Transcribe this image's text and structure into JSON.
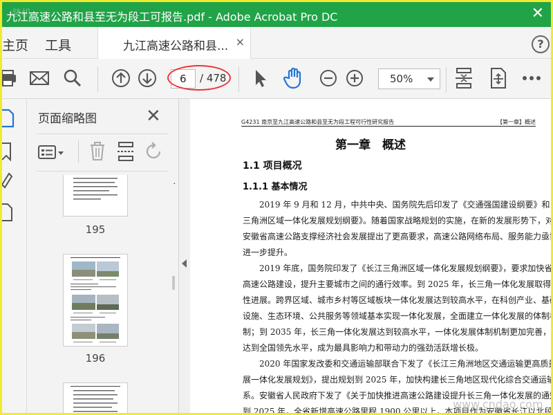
{
  "window": {
    "title": "九江高速公路和县至无为段工可报告.pdf - Adobe Acrobat Pro DC",
    "watermark_corner": "装机"
  },
  "tabs": {
    "home": "主页",
    "tools": "工具",
    "doc_tab": "九江高速公路和县...",
    "doc_close": "×",
    "help": "?"
  },
  "toolbar": {
    "page_current": "6",
    "page_total": "/ 478",
    "zoom": "50%"
  },
  "thumb_panel": {
    "title": "页面缩略图",
    "close": "✕",
    "pages": [
      "195",
      "196"
    ]
  },
  "document": {
    "running_head_left": "G4231 南京至九江高速公路和县至无为段工程可行性研究报告",
    "running_head_right": "【第一章】概述",
    "chapter_title": "第一章　概述",
    "section": "1.1 项目概况",
    "subsection": "1.1.1 基本情况",
    "paragraph1": [
      "　　2019 年 9 月和 12 月，中共中央、国务院先后印发了《交通强国建设纲要》和《长江",
      "三角洲区域一体化发展规划纲要》。随着国家战略规划的实施，在新的发展形势下，对",
      "安徽省高速公路支撑经济社会发展提出了更高要求，高速公路网络布局、服务能力亟需",
      "进一步提升。"
    ],
    "paragraph2": [
      "　　2019 年底，国务院印发了《长江三角洲区域一体化发展规划纲要》，要求加快省际",
      "高速公路建设，提升主要城市之间的通行效率。到 2025 年，长三角一体化发展取得实质",
      "性进展。跨界区域、城市乡村等区域板块一体化发展达到较高水平，在科创产业、基础",
      "设施、生态环境、公共服务等领域基本实现一体化发展，全面建立一体化发展的体制机",
      "制；到 2035 年，长三角一体化发展达到较高水平，一体化发展体制机制更加完善，整体",
      "达到全国领先水平，成为最具影响力和带动力的强劲活跃增长极。"
    ],
    "paragraph3": [
      "　　2020 年国家发改委和交通运输部联合下发了《长江三角洲地区交通运输更高质量发",
      "展一体化发展规划》，提出规划到 2025 年，加快构建长三角地区现代化综合交通运输体",
      "系。安徽省人民政府下发了《关于加快推进高速公路建设提升长三角一体化发展的通知》，",
      "到 2025 年，全省新增高速公路里程 1900 公里以上，本项目作为安徽省长江以北段对"
    ]
  },
  "watermark": "www.cndao.com"
}
